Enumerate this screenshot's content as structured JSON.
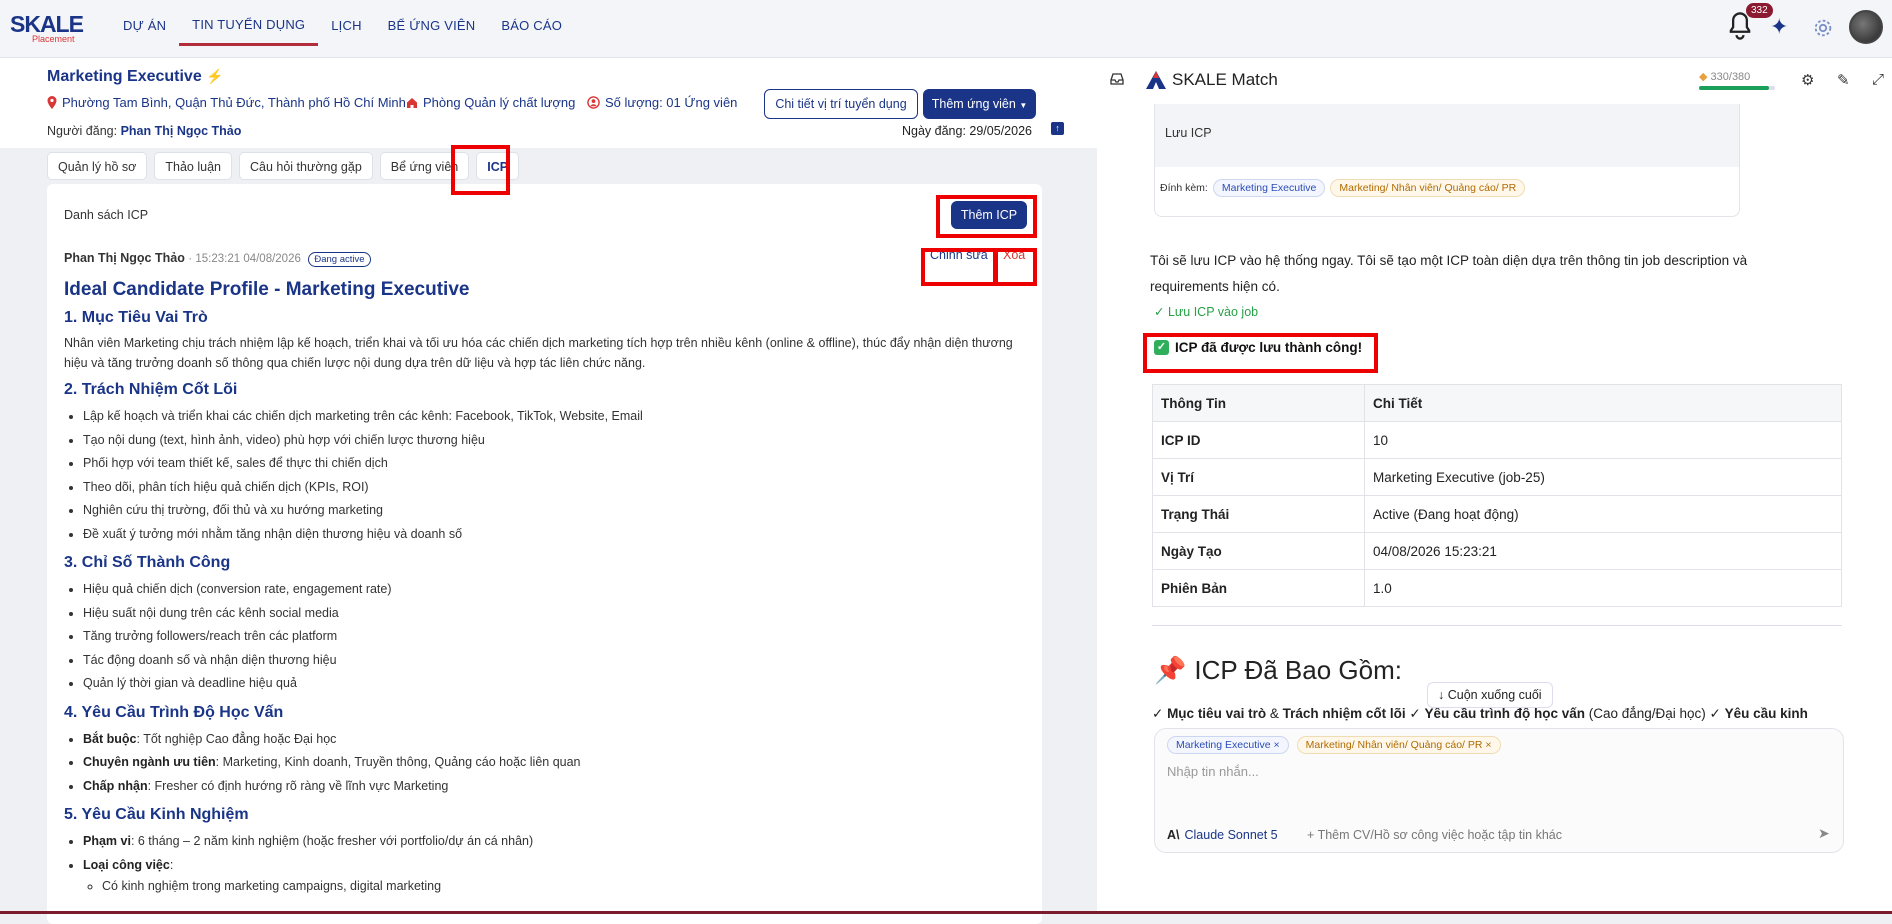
{
  "topbar": {
    "logo_main": "SKALE",
    "logo_sub": "Placement",
    "nav": [
      "DỰ ÁN",
      "TIN TUYỂN DỤNG",
      "LỊCH",
      "BỂ ỨNG VIÊN",
      "BÁO CÁO"
    ],
    "notif_count": "332"
  },
  "job": {
    "title": "Marketing Executive",
    "location": "Phường Tam Bình, Quận Thủ Đức, Thành phố Hồ Chí Minh",
    "department": "Phòng Quản lý chất lượng",
    "quantity": "Số lượng: 01 Ứng viên",
    "poster_label": "Người đăng:",
    "poster_name": "Phan Thị Ngọc Thảo",
    "post_date": "Ngày đăng: 29/05/2026",
    "detail_btn": "Chi tiết vị trí tuyển dụng",
    "add_candidate_btn": "Thêm ứng viên"
  },
  "tabs": [
    "Quản lý hồ sơ",
    "Thảo luận",
    "Câu hỏi thường gặp",
    "Bể ứng viên",
    "ICP"
  ],
  "icp": {
    "list_title": "Danh sách ICP",
    "add_btn": "Thêm ICP",
    "author": "Phan Thị Ngọc Thảo",
    "timestamp": "· 15:23:21 04/08/2026",
    "status": "Đang active",
    "edit": "Chỉnh sửa",
    "delete": "Xóa",
    "doc": {
      "title": "Ideal Candidate Profile - Marketing Executive",
      "s1": "1. Mục Tiêu Vai Trò",
      "s1_text": "Nhân viên Marketing chịu trách nhiệm lập kế hoạch, triển khai và tối ưu hóa các chiến dịch marketing tích hợp trên nhiều kênh (online & offline), thúc đẩy nhận diện thương hiệu và tăng trưởng doanh số thông qua chiến lược nội dung dựa trên dữ liệu và hợp tác liên chức năng.",
      "s2": "2. Trách Nhiệm Cốt Lõi",
      "s2_items": [
        "Lập kế hoạch và triển khai các chiến dịch marketing trên các kênh: Facebook, TikTok, Website, Email",
        "Tạo nội dung (text, hình ảnh, video) phù hợp với chiến lược thương hiệu",
        "Phối hợp với team thiết kế, sales để thực thi chiến dịch",
        "Theo dõi, phân tích hiệu quả chiến dịch (KPIs, ROI)",
        "Nghiên cứu thị trường, đối thủ và xu hướng marketing",
        "Đề xuất ý tưởng mới nhằm tăng nhận diện thương hiệu và doanh số"
      ],
      "s3": "3. Chỉ Số Thành Công",
      "s3_items": [
        "Hiệu quả chiến dịch (conversion rate, engagement rate)",
        "Hiệu suất nội dung trên các kênh social media",
        "Tăng trưởng followers/reach trên các platform",
        "Tác động doanh số và nhận diện thương hiệu",
        "Quản lý thời gian và deadline hiệu quả"
      ],
      "s4": "4. Yêu Cầu Trình Độ Học Vấn",
      "s4_items": [
        {
          "k": "Bắt buộc",
          "v": ": Tốt nghiệp Cao đẳng hoặc Đại học"
        },
        {
          "k": "Chuyên ngành ưu tiên",
          "v": ": Marketing, Kinh doanh, Truyền thông, Quảng cáo hoặc liên quan"
        },
        {
          "k": "Chấp nhận",
          "v": ": Fresher có định hướng rõ ràng về lĩnh vực Marketing"
        }
      ],
      "s5": "5. Yêu Cầu Kinh Nghiệm",
      "s5_items": [
        {
          "k": "Phạm vi",
          "v": ": 6 tháng – 2 năm kinh nghiệm (hoặc fresher với portfolio/dự án cá nhân)"
        },
        {
          "k": "Loại công việc",
          "v": ":"
        }
      ],
      "s5_sub": "Có kinh nghiệm trong marketing campaigns, digital marketing"
    }
  },
  "chat": {
    "title": "SKALE Match",
    "credits": "330/380",
    "prev_msg": "Lưu ICP",
    "attach_label": "Đính kèm:",
    "chip1": "Marketing Executive",
    "chip2": "Marketing/ Nhân viên/ Quảng cáo/ PR",
    "answer": "Tôi sẽ lưu ICP vào hệ thống ngay. Tôi sẽ tạo một ICP toàn diện dựa trên thông tin job description và requirements hiện có.",
    "tool_done": "Lưu ICP vào job",
    "success": "ICP đã được lưu thành công!",
    "table_head": [
      "Thông Tin",
      "Chi Tiết"
    ],
    "table_rows": [
      [
        "ICP ID",
        "10"
      ],
      [
        "Vị Trí",
        "Marketing Executive (job-25)"
      ],
      [
        "Trạng Thái",
        "Active (Đang hoạt động)"
      ],
      [
        "Ngày Tạo",
        "04/08/2026 15:23:21"
      ],
      [
        "Phiên Bản",
        "1.0"
      ]
    ],
    "included_title": "ICP Đã Bao Gồm:",
    "scroll_btn": "Cuộn xuống cuối",
    "included_line": "<b>Mục tiêu vai trò</b> & <b>Trách nhiệm cốt lõi</b> ✓ <b>Yêu cầu trình độ học vấn</b> (Cao đẳng/Đại học) ✓ <b>Yêu cầu kinh</b>",
    "placeholder": "Nhập tin nhắn...",
    "model": "Claude Sonnet 5",
    "attach": "Thêm CV/Hồ sơ công việc hoặc tập tin khác"
  }
}
